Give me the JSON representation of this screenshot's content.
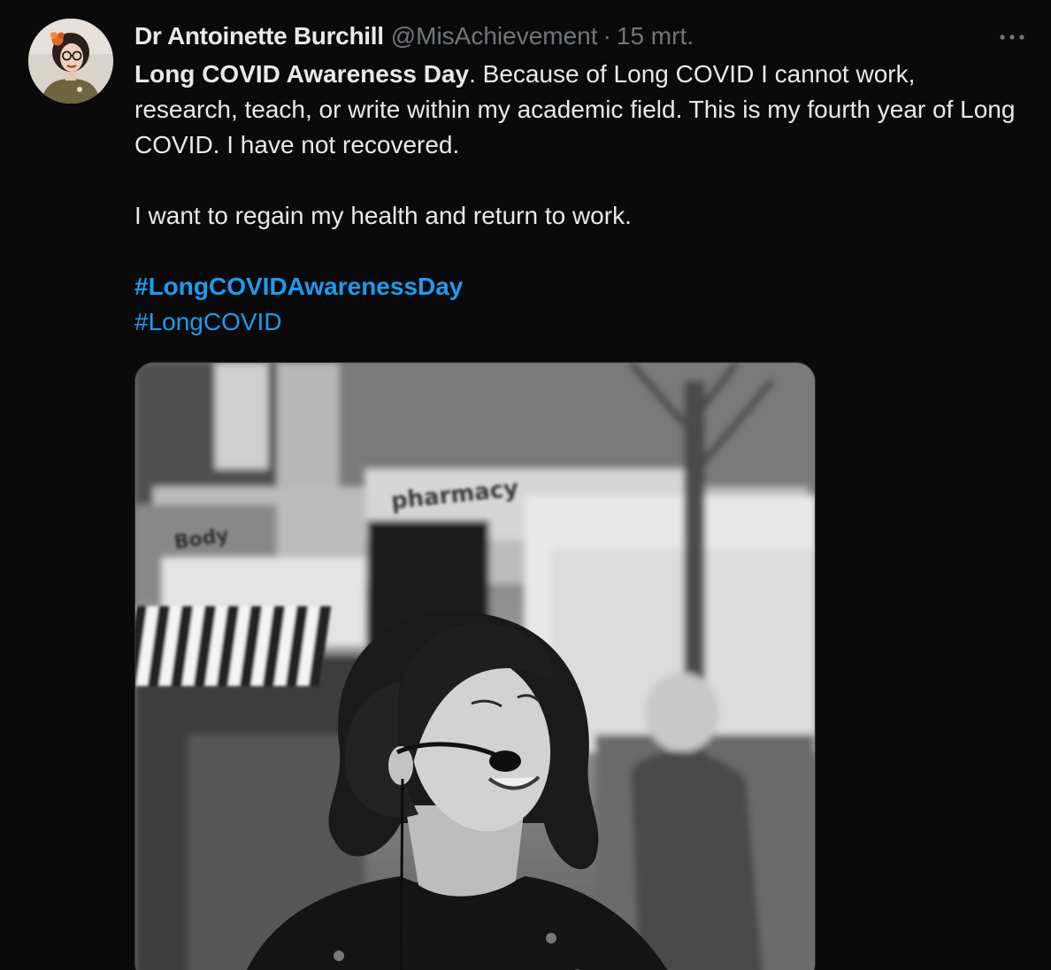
{
  "tweet": {
    "author": {
      "display_name": "Dr Antoinette Burchill",
      "handle": "@MisAchievement"
    },
    "separator": "·",
    "date": "15 mrt.",
    "more_label": "···",
    "text": {
      "bold_lead": "Long COVID Awareness Day",
      "line1_rest": ". Because of Long COVID I cannot work, research, teach, or write within my academic field. This is my fourth year of Long COVID. I have not recovered.",
      "paragraph2": "I want to regain my health and return to work."
    },
    "hashtags": [
      "#LongCOVIDAwarenessDay",
      "#LongCOVID"
    ],
    "media": {
      "storefront_sign": "pharmacy",
      "side_sign": "Body"
    }
  },
  "colors": {
    "background": "#0a0a0a",
    "text": "#e7e9ea",
    "muted": "#71767b",
    "link": "#1d9bf0"
  }
}
